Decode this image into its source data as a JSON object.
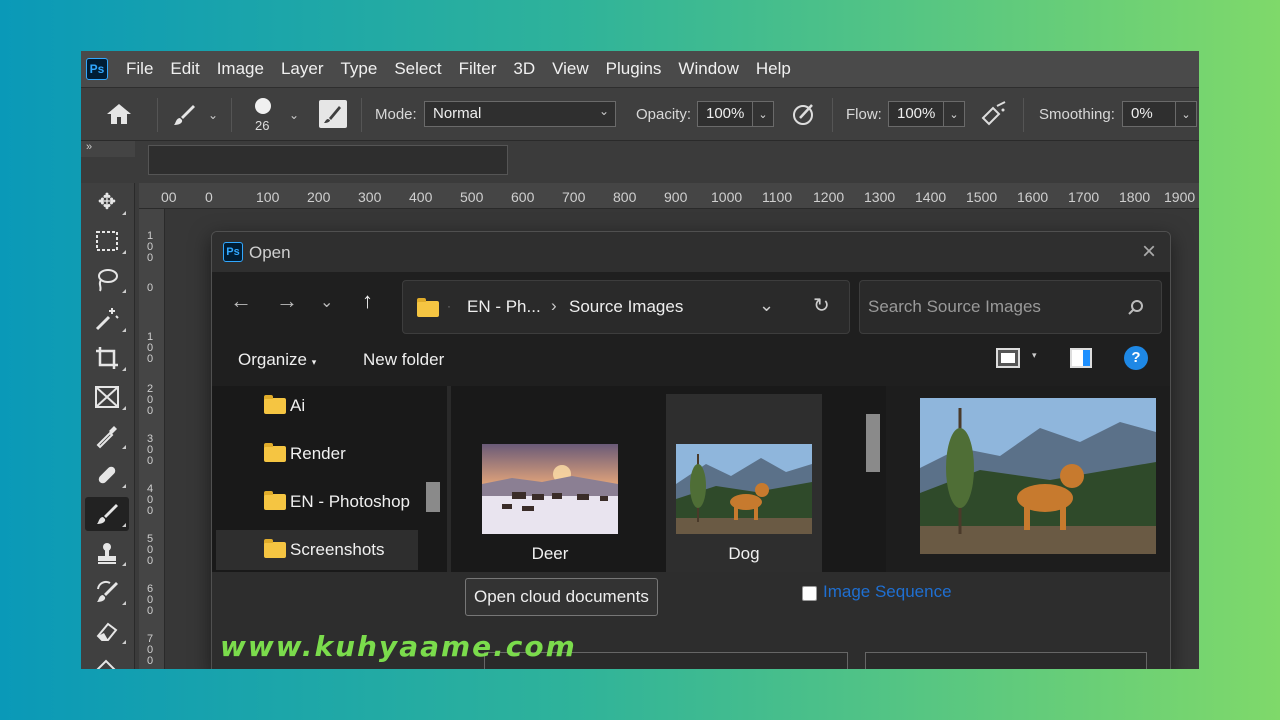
{
  "menubar": {
    "logo": "Ps",
    "items": [
      "File",
      "Edit",
      "Image",
      "Layer",
      "Type",
      "Select",
      "Filter",
      "3D",
      "View",
      "Plugins",
      "Window",
      "Help"
    ]
  },
  "options": {
    "brush_size": "26",
    "mode_label": "Mode:",
    "mode_value": "Normal",
    "opacity_label": "Opacity:",
    "opacity_value": "100%",
    "flow_label": "Flow:",
    "flow_value": "100%",
    "smoothing_label": "Smoothing:",
    "smoothing_value": "0%"
  },
  "panel_collapse": "»",
  "ruler": {
    "h_ticks": [
      "00",
      "0",
      "100",
      "200",
      "300",
      "400",
      "500",
      "600",
      "700",
      "800",
      "900",
      "1000",
      "1100",
      "1200",
      "1300",
      "1400",
      "1500",
      "1600",
      "1700",
      "1800",
      "1900"
    ],
    "v_ticks": [
      "1\n0\n0",
      "0",
      "1\n0\n0",
      "2\n0\n0",
      "3\n0\n0",
      "4\n0\n0",
      "5\n0\n0",
      "6\n0\n0",
      "7\n0\n0"
    ]
  },
  "dialog": {
    "title": "Open",
    "logo": "Ps",
    "close": "×",
    "address": {
      "crumb1": "EN - Ph...",
      "sep": "›",
      "crumb2": "Source Images"
    },
    "search_placeholder": "Search Source Images",
    "organize": "Organize",
    "new_folder": "New folder",
    "help": "?",
    "tree": [
      "Ai",
      "Render",
      "EN - Photoshop",
      "Screenshots"
    ],
    "files": [
      {
        "label": "Deer"
      },
      {
        "label": "Dog"
      }
    ],
    "open_cloud": "Open cloud documents",
    "image_sequence": "Image Sequence"
  },
  "watermark": "www.kuhyaame.com",
  "colors": {
    "ps_blue": "#31a8ff",
    "folder_yellow": "#f5c542",
    "link_blue": "#1f6fd1",
    "watermark_green": "#7bdc4c"
  }
}
